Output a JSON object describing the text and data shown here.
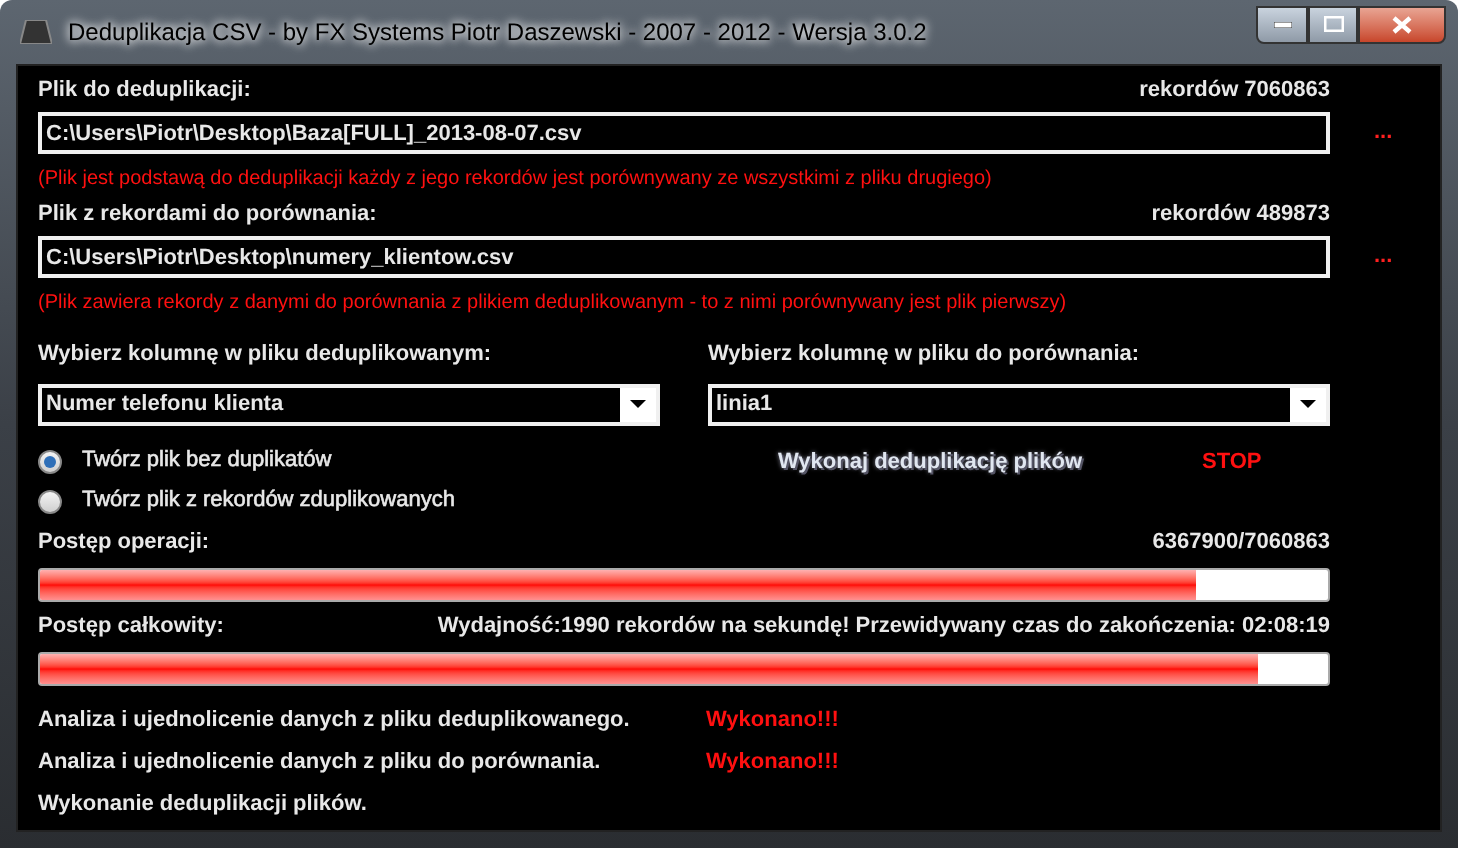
{
  "window": {
    "title": "Deduplikacja CSV - by FX Systems Piotr Daszewski - 2007 - 2012 - Wersja 3.0.2"
  },
  "files": [
    {
      "label": "Plik do deduplikacji:",
      "count": "rekordów 7060863",
      "value": "C:\\Users\\Piotr\\Desktop\\Baza[FULL]_2013-08-07.csv",
      "browse": "...",
      "note": "(Plik jest podstawą do deduplikacji każdy z jego rekordów jest porównywany ze wszystkimi z pliku drugiego)"
    },
    {
      "label": "Plik z rekordami do porównania:",
      "count": "rekordów 489873",
      "value": "C:\\Users\\Piotr\\Desktop\\numery_klientow.csv",
      "browse": "...",
      "note": "(Plik zawiera rekordy z danymi do porównania z plikiem deduplikowanym - to z nimi porównywany jest plik pierwszy)"
    }
  ],
  "columns": [
    {
      "label": "Wybierz kolumnę w pliku deduplikowanym:",
      "value": "Numer telefonu klienta"
    },
    {
      "label": "Wybierz kolumnę w pliku do porównania:",
      "value": "linia1"
    }
  ],
  "modes": [
    {
      "label": "Twórz plik bez duplikatów",
      "selected": true
    },
    {
      "label": "Twórz plik z rekordów zduplikowanych",
      "selected": false
    }
  ],
  "run_button": "Wykonaj deduplikację plików",
  "stop_button": "STOP",
  "progress": [
    {
      "label": "Postęp operacji:",
      "reading": "6367900/7060863",
      "level": 0.897
    },
    {
      "label": "Postęp całkowity:",
      "reading": "Wydajność:1990 rekordów na sekundę! Przewidywany czas do zakończenia: 02:08:19",
      "level": 0.946
    }
  ],
  "steps": [
    {
      "label": "Analiza i ujednolicenie danych z pliku deduplikowanego.",
      "status": "Wykonano!!!"
    },
    {
      "label": "Analiza i ujednolicenie danych z pliku do porównania.",
      "status": "Wykonano!!!"
    },
    {
      "label": "Wykonanie deduplikacji plików."
    }
  ]
}
